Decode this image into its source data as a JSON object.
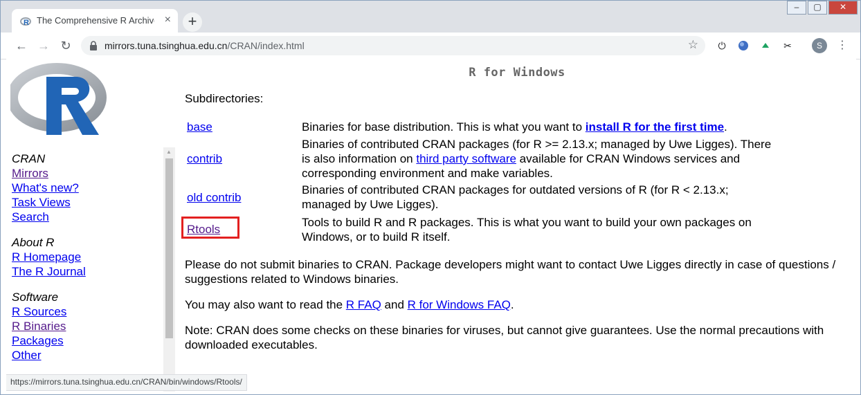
{
  "browser": {
    "tab_title": "The Comprehensive R Archive",
    "tab_close": "×",
    "new_tab": "+",
    "url_host": "mirrors.tuna.tsinghua.edu.cn",
    "url_path": "/CRAN/index.html",
    "avatar_initial": "S",
    "status_url": "https://mirrors.tuna.tsinghua.edu.cn/CRAN/bin/windows/Rtools/"
  },
  "sidebar": {
    "cran_heading": "CRAN",
    "cran_links": [
      "Mirrors",
      "What's new?",
      "Task Views",
      "Search"
    ],
    "about_heading": "About R",
    "about_links": [
      "R Homepage",
      "The R Journal"
    ],
    "software_heading": "Software",
    "software_links": [
      "R Sources",
      "R Binaries",
      "Packages",
      "Other"
    ]
  },
  "main": {
    "title": "R for Windows",
    "subdir_heading": "Subdirectories:",
    "rows": [
      {
        "name": "base",
        "desc_before": "Binaries for base distribution. This is what you want to ",
        "desc_link": "install R for the first time",
        "desc_after": "."
      },
      {
        "name": "contrib",
        "desc_before": "Binaries of contributed CRAN packages (for R >= 2.13.x; managed by Uwe Ligges). There is also information on ",
        "desc_link": "third party software",
        "desc_after": " available for CRAN Windows services and corresponding environment and make variables."
      },
      {
        "name": "old contrib",
        "desc": "Binaries of contributed CRAN packages for outdated versions of R (for R < 2.13.x; managed by Uwe Ligges)."
      },
      {
        "name": "Rtools",
        "desc": "Tools to build R and R packages. This is what you want to build your own packages on Windows, or to build R itself."
      }
    ],
    "para1": "Please do not submit binaries to CRAN. Package developers might want to contact Uwe Ligges directly in case of questions / suggestions related to Windows binaries.",
    "para2_before": "You may also want to read the ",
    "para2_link1": "R FAQ",
    "para2_mid": " and ",
    "para2_link2": "R for Windows FAQ",
    "para2_after": ".",
    "para3": "Note: CRAN does some checks on these binaries for viruses, but cannot give guarantees. Use the normal precautions with downloaded executables."
  },
  "colors": {
    "link": "#0000ee",
    "visited_link": "#551a8b",
    "highlight": "#e32020"
  }
}
